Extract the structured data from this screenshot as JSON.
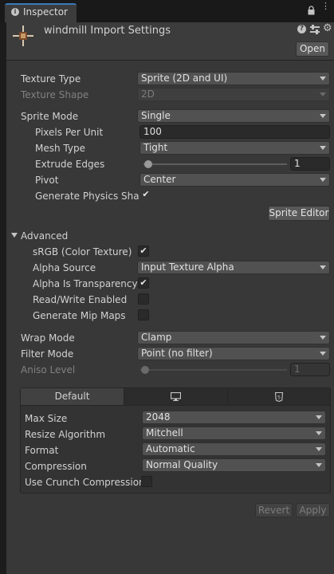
{
  "tab": {
    "title": "Inspector"
  },
  "header": {
    "title": "windmill Import Settings",
    "open_label": "Open"
  },
  "texture": {
    "type_label": "Texture Type",
    "type_value": "Sprite (2D and UI)",
    "shape_label": "Texture Shape",
    "shape_value": "2D"
  },
  "sprite": {
    "mode_label": "Sprite Mode",
    "mode_value": "Single",
    "ppu_label": "Pixels Per Unit",
    "ppu_value": "100",
    "mesh_label": "Mesh Type",
    "mesh_value": "Tight",
    "extrude_label": "Extrude Edges",
    "extrude_value": "1",
    "pivot_label": "Pivot",
    "pivot_value": "Center",
    "physics_label": "Generate Physics Shap",
    "physics_checked": true,
    "editor_button": "Sprite Editor"
  },
  "advanced": {
    "foldout_label": "Advanced",
    "srgb_label": "sRGB (Color Texture)",
    "srgb_checked": true,
    "alpha_source_label": "Alpha Source",
    "alpha_source_value": "Input Texture Alpha",
    "alpha_transparency_label": "Alpha Is Transparency",
    "alpha_transparency_checked": true,
    "readwrite_label": "Read/Write Enabled",
    "readwrite_checked": false,
    "mipmaps_label": "Generate Mip Maps",
    "mipmaps_checked": false
  },
  "sampling": {
    "wrap_label": "Wrap Mode",
    "wrap_value": "Clamp",
    "filter_label": "Filter Mode",
    "filter_value": "Point (no filter)",
    "aniso_label": "Aniso Level",
    "aniso_value": "1"
  },
  "platform": {
    "default_tab": "Default",
    "max_size_label": "Max Size",
    "max_size_value": "2048",
    "resize_label": "Resize Algorithm",
    "resize_value": "Mitchell",
    "format_label": "Format",
    "format_value": "Automatic",
    "compression_label": "Compression",
    "compression_value": "Normal Quality",
    "crunch_label": "Use Crunch Compression",
    "crunch_checked": false
  },
  "footer": {
    "revert_label": "Revert",
    "apply_label": "Apply"
  },
  "colors": {
    "tab_accent": "#3a79bb",
    "panel_bg": "#383838",
    "window_bg": "#1c1c1c"
  }
}
